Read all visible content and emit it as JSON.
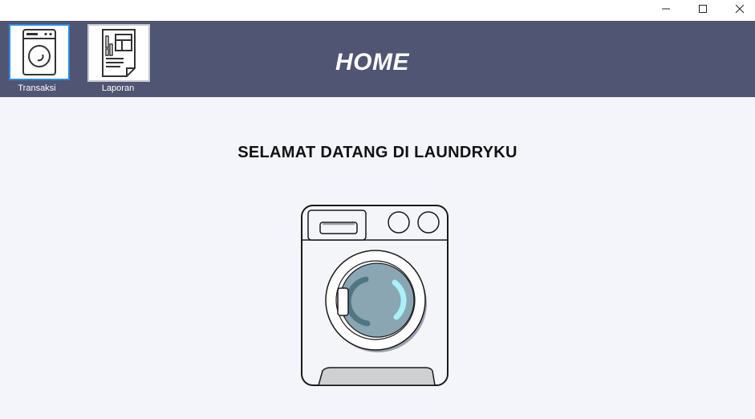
{
  "window": {
    "controls": {
      "minimize_icon": "minimize-icon",
      "maximize_icon": "maximize-icon",
      "close_icon": "close-icon"
    }
  },
  "header": {
    "title": "HOME",
    "background": "#4f5573",
    "nav": [
      {
        "label": "Transaksi",
        "icon": "washing-machine-icon",
        "selected": true
      },
      {
        "label": "Laporan",
        "icon": "report-icon",
        "selected": false
      }
    ]
  },
  "main": {
    "welcome": "SELAMAT DATANG DI LAUNDRYKU",
    "illustration": "washing-machine-illustration",
    "background": "#f4f5fa"
  }
}
